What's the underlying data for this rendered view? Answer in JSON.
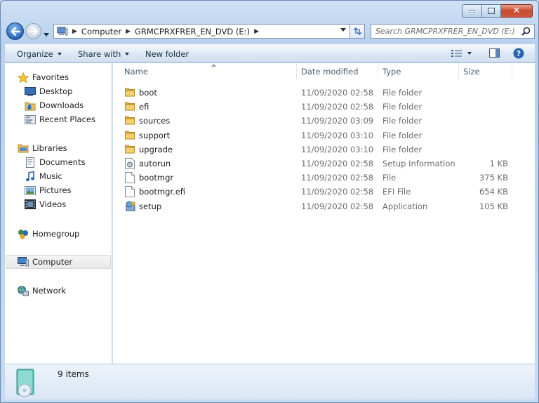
{
  "window": {
    "caption_buttons": {
      "minimize": "–",
      "maximize": "□",
      "close": "✕"
    }
  },
  "address_bar": {
    "crumbs": [
      "Computer",
      "GRMCPRXFRER_EN_DVD (E:)"
    ]
  },
  "search": {
    "placeholder": "Search GRMCPRXFRER_EN_DVD (E:)"
  },
  "toolbar": {
    "organize": "Organize",
    "share_with": "Share with",
    "new_folder": "New folder"
  },
  "sidebar": {
    "favorites": {
      "label": "Favorites",
      "items": [
        "Desktop",
        "Downloads",
        "Recent Places"
      ]
    },
    "libraries": {
      "label": "Libraries",
      "items": [
        "Documents",
        "Music",
        "Pictures",
        "Videos"
      ]
    },
    "homegroup": "Homegroup",
    "computer": "Computer",
    "network": "Network",
    "selected": "Computer"
  },
  "columns": [
    "Name",
    "Date modified",
    "Type",
    "Size"
  ],
  "files": [
    {
      "name": "boot",
      "date": "11/09/2020 02:58",
      "type": "File folder",
      "size": "",
      "icon": "folder-icon"
    },
    {
      "name": "efi",
      "date": "11/09/2020 02:58",
      "type": "File folder",
      "size": "",
      "icon": "folder-icon"
    },
    {
      "name": "sources",
      "date": "11/09/2020 03:09",
      "type": "File folder",
      "size": "",
      "icon": "folder-icon"
    },
    {
      "name": "support",
      "date": "11/09/2020 03:10",
      "type": "File folder",
      "size": "",
      "icon": "folder-icon"
    },
    {
      "name": "upgrade",
      "date": "11/09/2020 03:10",
      "type": "File folder",
      "size": "",
      "icon": "folder-icon"
    },
    {
      "name": "autorun",
      "date": "11/09/2020 02:58",
      "type": "Setup Information",
      "size": "1 KB",
      "icon": "setup-info-file-icon"
    },
    {
      "name": "bootmgr",
      "date": "11/09/2020 02:58",
      "type": "File",
      "size": "375 KB",
      "icon": "blank-file-icon"
    },
    {
      "name": "bootmgr.efi",
      "date": "11/09/2020 02:58",
      "type": "EFI File",
      "size": "654 KB",
      "icon": "blank-file-icon"
    },
    {
      "name": "setup",
      "date": "11/09/2020 02:58",
      "type": "Application",
      "size": "105 KB",
      "icon": "setup-application-icon"
    }
  ],
  "status": {
    "item_count": "9 items"
  }
}
